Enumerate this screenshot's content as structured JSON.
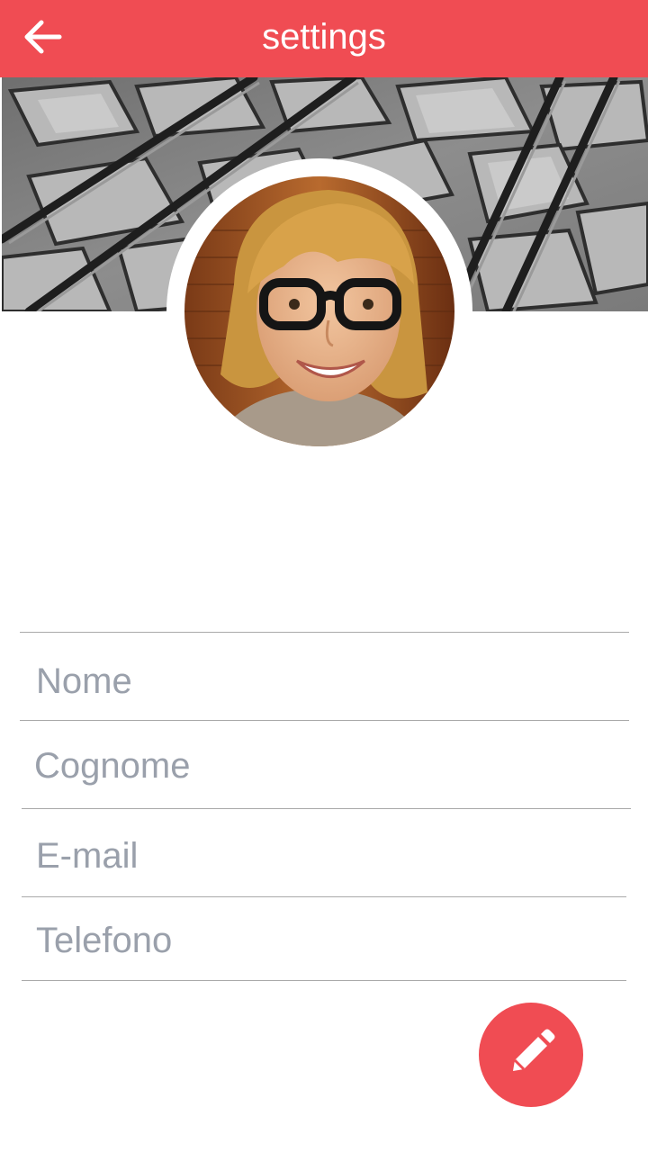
{
  "app_bar": {
    "title": "settings",
    "back_icon": "arrow-back-icon",
    "color": "#f04c53"
  },
  "profile": {
    "cover_image": "cobblestone-tram-tracks-photo",
    "avatar_image": "woman-with-glasses-photo"
  },
  "form": {
    "fields": [
      {
        "placeholder": "Nome"
      },
      {
        "placeholder": "Cognome"
      },
      {
        "placeholder": "E-mail"
      },
      {
        "placeholder": "Telefono"
      }
    ],
    "placeholder_color": "#9aa0ab"
  },
  "fab": {
    "icon": "pencil-icon",
    "color": "#f04c53"
  }
}
